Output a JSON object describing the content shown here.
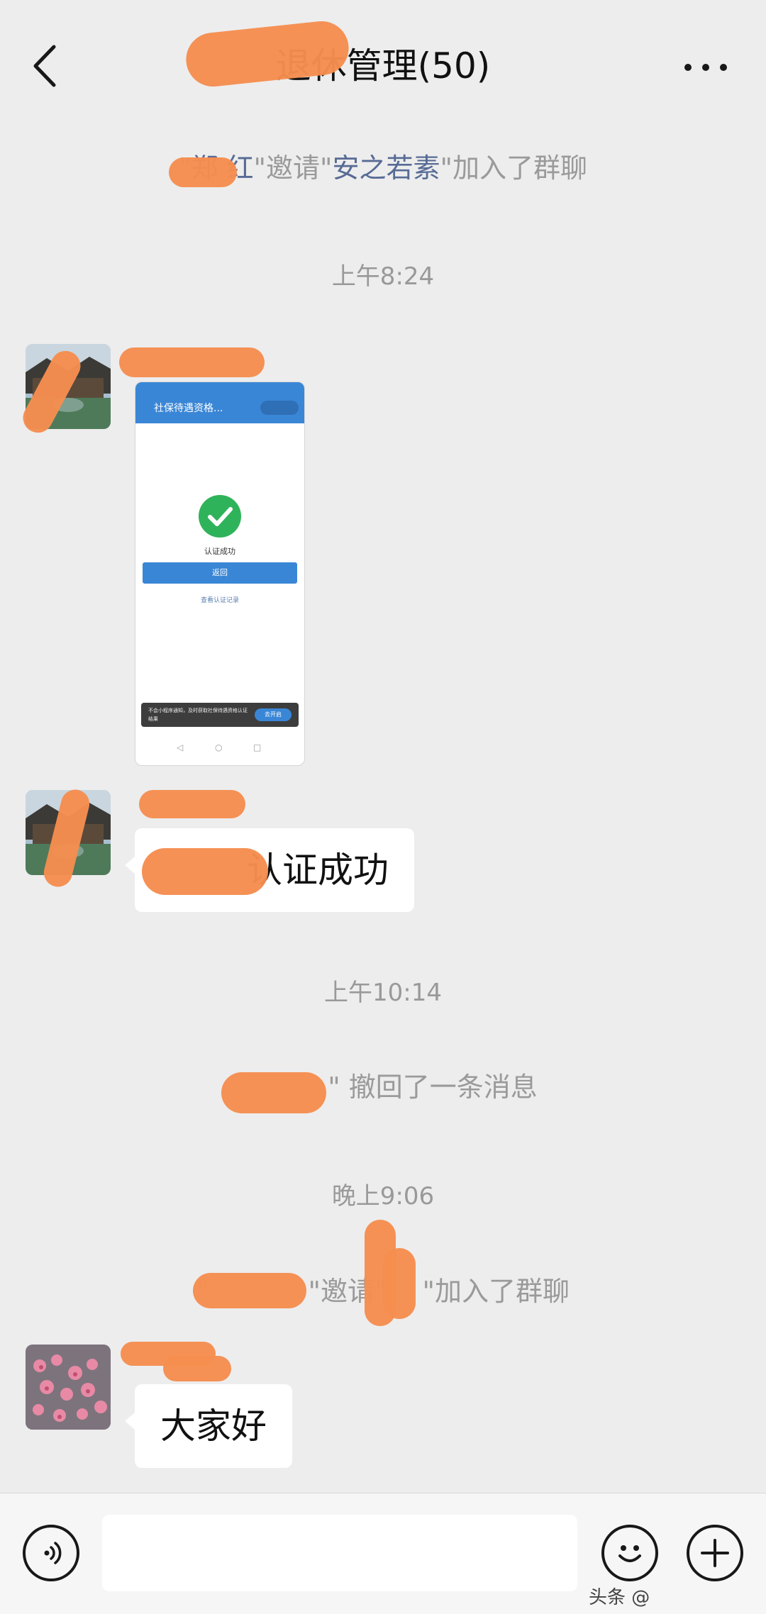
{
  "header": {
    "title": "退休管理(50)",
    "back_icon": "back-arrow-icon",
    "more_icon": "more-dots-icon"
  },
  "messages": {
    "notice1": {
      "q1": "\"",
      "inviter": "郑  红",
      "q2": "\"",
      "mid": "邀请",
      "q3": "\"",
      "invitee": "安之若素",
      "q4": "\"",
      "tail": "加入了群聊"
    },
    "time1": "上午8:24",
    "msg2": {
      "text": "认证成功"
    },
    "time2": "上午10:14",
    "notice2": {
      "text": "\" 撤回了一条消息"
    },
    "time3": "晚上9:06",
    "notice3": {
      "q1": "\"",
      "q2": "\"",
      "mid": "邀请",
      "q3": "\"",
      "q4": "\"",
      "tail": "加入了群聊"
    },
    "msg3": {
      "text": "大家好"
    }
  },
  "screenshot": {
    "header_text": "社保待遇资格...",
    "success_text": "认证成功",
    "button_text": "返回",
    "link_text": "查看认证记录",
    "banner_text": "不会小程序通知，及时获取社保待遇资格认证结果",
    "banner_button": "去开启"
  },
  "input_bar": {
    "voice_icon": "voice-icon",
    "emoji_icon": "emoji-icon",
    "plus_icon": "plus-icon"
  },
  "watermark": "头条 @"
}
